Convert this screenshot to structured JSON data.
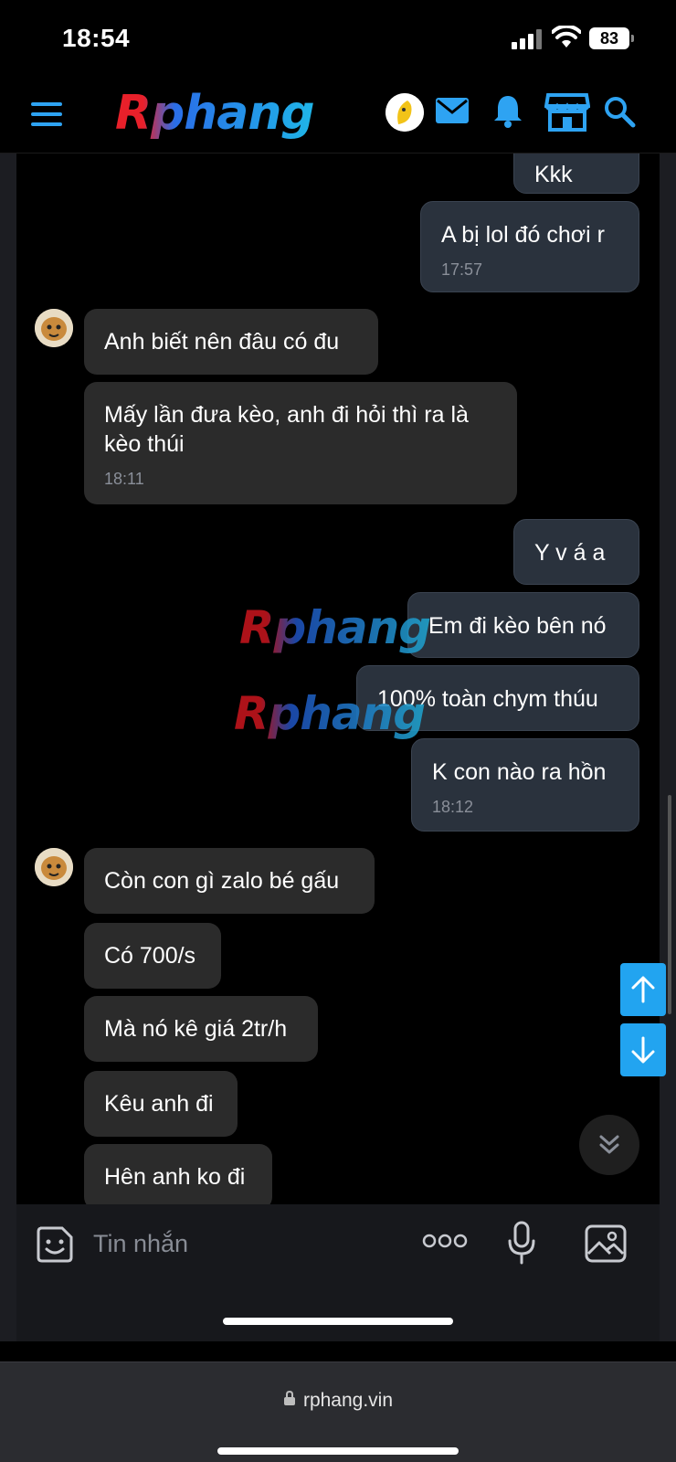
{
  "status": {
    "time": "18:54",
    "battery": "83"
  },
  "header": {
    "logo": "Rphang"
  },
  "watermark": "Rphang",
  "messages": [
    {
      "text": "Kkk",
      "time": ""
    },
    {
      "text": "A bị lol đó chơi r",
      "time": "17:57"
    },
    {
      "text": "Anh biết nên đâu có đu",
      "time": ""
    },
    {
      "text": "Mấy lần đưa kèo, anh đi hỏi thì ra là kèo thúi",
      "time": "18:11"
    },
    {
      "text": "Y v á a",
      "time": ""
    },
    {
      "text": "Em đi kèo bên nó",
      "time": ""
    },
    {
      "text": "100% toàn chym thúu",
      "time": ""
    },
    {
      "text": "K con nào ra hồn",
      "time": "18:12"
    },
    {
      "text": "Còn con gì zalo bé gấu",
      "time": ""
    },
    {
      "text": "Có 700/s",
      "time": ""
    },
    {
      "text": "Mà nó kê giá 2tr/h",
      "time": ""
    },
    {
      "text": "Kêu anh đi",
      "time": ""
    },
    {
      "text": "Hên anh ko đi",
      "time": ""
    }
  ],
  "composer": {
    "placeholder": "Tin nhắn"
  },
  "browser": {
    "url": "rphang.vin"
  },
  "icons": {
    "menu": "hamburger-icon",
    "mail": "mail-icon",
    "bell": "bell-icon",
    "store": "store-icon",
    "search": "search-icon",
    "sticker": "sticker-icon",
    "more": "more-icon",
    "mic": "mic-icon",
    "image": "image-icon",
    "lock": "lock-icon"
  },
  "colors": {
    "accent": "#2ea3f2",
    "outgoing_bubble": "#2a323d",
    "incoming_bubble": "#2b2b2b"
  }
}
